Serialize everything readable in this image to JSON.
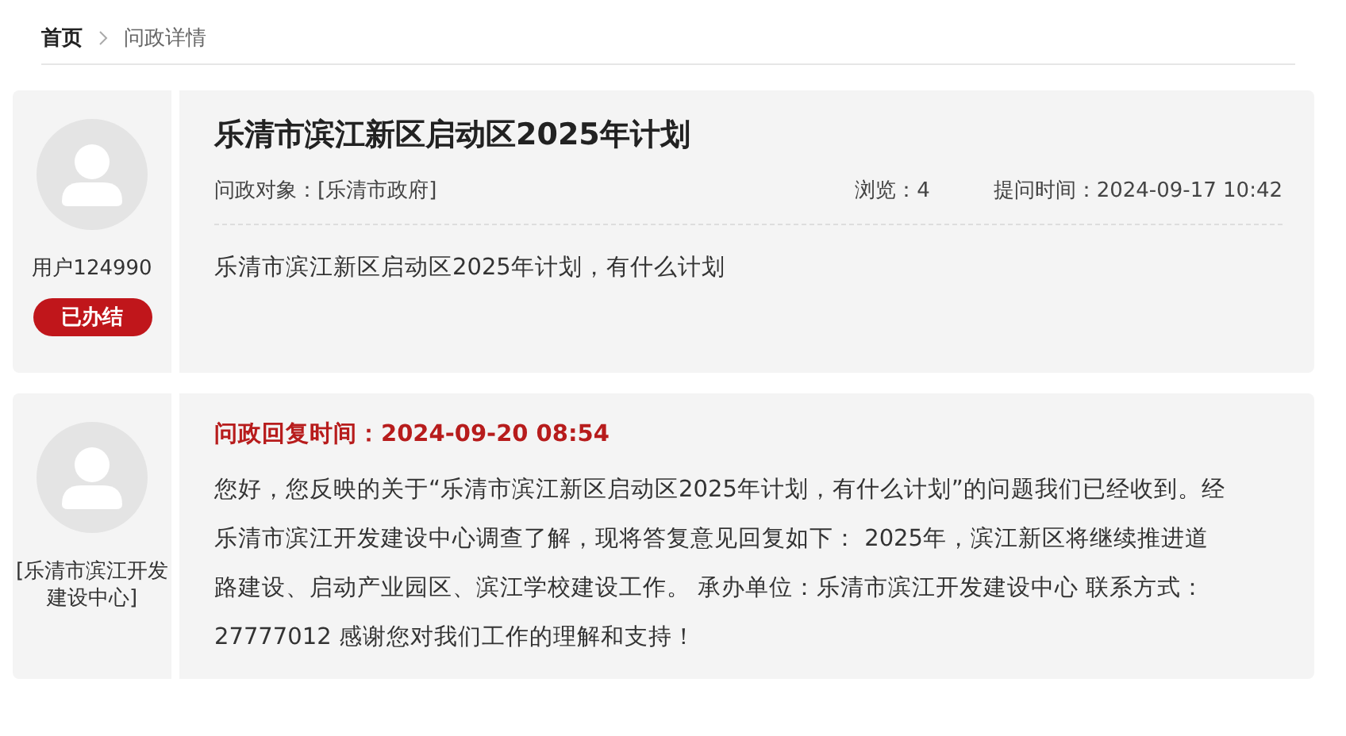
{
  "breadcrumb": [
    {
      "label": "首页",
      "kind": "link"
    },
    {
      "label": "问政详情",
      "kind": "current"
    }
  ],
  "question": {
    "author": "用户124990",
    "status": "已办结",
    "title": "乐清市滨江新区启动区2025年计划",
    "target": "问政对象：[乐清市政府]",
    "views": "浏览：4",
    "asked_at": "提问时间：2024-09-17 10:42",
    "body": "乐清市滨江新区启动区2025年计划，有什么计划"
  },
  "reply": {
    "author": "[乐清市滨江开发建设中心]",
    "replied_at": "问政回复时间：2024-09-20 08:54",
    "body": "您好，您反映的关于“乐清市滨江新区启动区2025年计划，有什么计划”的问题我们已经收到。经乐清市滨江开发建设中心调查了解，现将答复意见回复如下： 2025年，滨江新区将继续推进道路建设、启动产业园区、滨江学校建设工作。 承办单位：乐清市滨江开发建设中心 联系方式：27777012 感谢您对我们工作的理解和支持！"
  }
}
